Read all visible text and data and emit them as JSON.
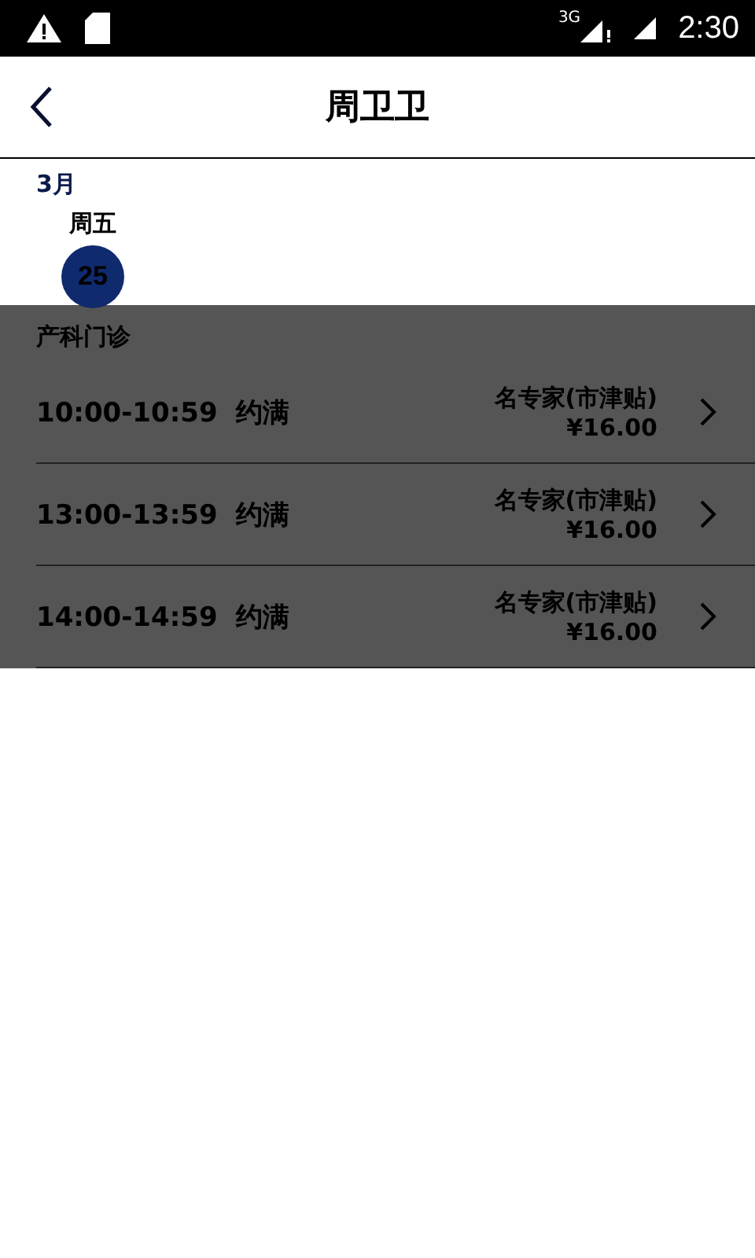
{
  "status_bar": {
    "network": "3G",
    "time": "2:30"
  },
  "header": {
    "title": "周卫卫"
  },
  "calendar": {
    "month": "3月",
    "days": [
      {
        "weekday": "周五",
        "date": "25",
        "selected": true
      }
    ]
  },
  "department": "产科门诊",
  "slots": [
    {
      "time": "10:00-10:59",
      "status": "约满",
      "level": "名专家(市津贴)",
      "price": "¥16.00"
    },
    {
      "time": "13:00-13:59",
      "status": "约满",
      "level": "名专家(市津贴)",
      "price": "¥16.00"
    },
    {
      "time": "14:00-14:59",
      "status": "约满",
      "level": "名专家(市津贴)",
      "price": "¥16.00"
    }
  ]
}
